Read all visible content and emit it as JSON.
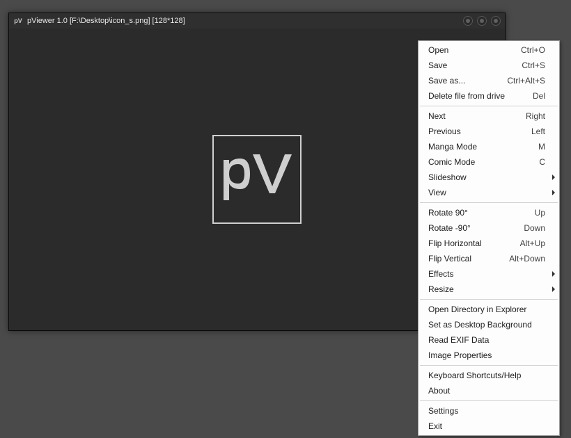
{
  "window": {
    "title": "pViewer 1.0 [F:\\Desktop\\icon_s.png] [128*128]",
    "logo_text": "pV"
  },
  "menu": {
    "items": [
      {
        "label": "Open",
        "shortcut": "Ctrl+O"
      },
      {
        "label": "Save",
        "shortcut": "Ctrl+S"
      },
      {
        "label": "Save as...",
        "shortcut": "Ctrl+Alt+S"
      },
      {
        "label": "Delete file from drive",
        "shortcut": "Del"
      },
      {
        "sep": true
      },
      {
        "label": "Next",
        "shortcut": "Right"
      },
      {
        "label": "Previous",
        "shortcut": "Left"
      },
      {
        "label": "Manga Mode",
        "shortcut": "M"
      },
      {
        "label": "Comic Mode",
        "shortcut": "C"
      },
      {
        "label": "Slideshow",
        "submenu": true
      },
      {
        "label": "View",
        "submenu": true
      },
      {
        "sep": true
      },
      {
        "label": "Rotate 90°",
        "shortcut": "Up"
      },
      {
        "label": "Rotate -90°",
        "shortcut": "Down"
      },
      {
        "label": "Flip Horizontal",
        "shortcut": "Alt+Up"
      },
      {
        "label": "Flip Vertical",
        "shortcut": "Alt+Down"
      },
      {
        "label": "Effects",
        "submenu": true
      },
      {
        "label": "Resize",
        "submenu": true
      },
      {
        "sep": true
      },
      {
        "label": "Open Directory in Explorer"
      },
      {
        "label": "Set as Desktop Background"
      },
      {
        "label": "Read EXIF Data"
      },
      {
        "label": "Image Properties"
      },
      {
        "sep": true
      },
      {
        "label": "Keyboard Shortcuts/Help"
      },
      {
        "label": "About"
      },
      {
        "sep": true
      },
      {
        "label": "Settings"
      },
      {
        "label": "Exit"
      }
    ]
  }
}
